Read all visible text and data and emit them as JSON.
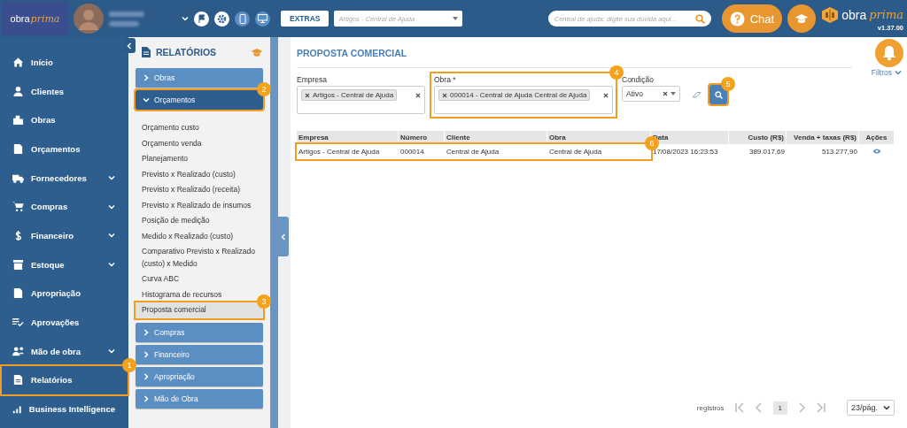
{
  "header": {
    "logo": {
      "text": "obra",
      "script": "prima"
    },
    "extras_button": "EXTRAS",
    "company_select": {
      "placeholder": "Artigos - Central de Ajuda"
    },
    "help_search": {
      "placeholder": "Central de ajuda: digite sua dúvida aqui..."
    },
    "chat_button": "Chat",
    "brand": {
      "text": "obra",
      "script": "prima",
      "version": "v1.37.00"
    }
  },
  "sidebar": {
    "items": [
      {
        "label": "Início",
        "expandable": false
      },
      {
        "label": "Clientes",
        "expandable": false
      },
      {
        "label": "Obras",
        "expandable": false
      },
      {
        "label": "Orçamentos",
        "expandable": false
      },
      {
        "label": "Fornecedores",
        "expandable": true
      },
      {
        "label": "Compras",
        "expandable": true
      },
      {
        "label": "Financeiro",
        "expandable": true
      },
      {
        "label": "Estoque",
        "expandable": true
      },
      {
        "label": "Apropriação",
        "expandable": false
      },
      {
        "label": "Aprovações",
        "expandable": false
      },
      {
        "label": "Mão de obra",
        "expandable": true
      },
      {
        "label": "Relatórios",
        "expandable": false,
        "callout": "1"
      },
      {
        "label": "Business Intelligence",
        "expandable": false
      }
    ]
  },
  "submenu": {
    "title": "RELATÓRIOS",
    "groups": [
      {
        "label": "Obras",
        "expanded": false
      },
      {
        "label": "Orçamentos",
        "expanded": true,
        "callout": "2",
        "children": [
          {
            "label": "Orçamento custo",
            "selected": false
          },
          {
            "label": "Orçamento venda",
            "selected": false
          },
          {
            "label": "Planejamento",
            "selected": false
          },
          {
            "label": "Previsto x Realizado (custo)",
            "selected": false
          },
          {
            "label": "Previsto x Realizado (receita)",
            "selected": false
          },
          {
            "label": "Previsto x Realizado de insumos",
            "selected": false
          },
          {
            "label": "Posição de medição",
            "selected": false
          },
          {
            "label": "Medido x Realizado (custo)",
            "selected": false
          },
          {
            "label": "Comparativo Previsto x Realizado (custo) x Medido",
            "selected": false
          },
          {
            "label": "Curva ABC",
            "selected": false
          },
          {
            "label": "Histograma de recursos",
            "selected": false
          },
          {
            "label": "Proposta comercial",
            "selected": true,
            "callout": "3"
          }
        ]
      },
      {
        "label": "Compras",
        "expanded": false
      },
      {
        "label": "Financeiro",
        "expanded": false
      },
      {
        "label": "Apropriação",
        "expanded": false
      },
      {
        "label": "Mão de Obra",
        "expanded": false
      }
    ]
  },
  "main": {
    "title": "PROPOSTA COMERCIAL",
    "filters_link": "Filtros",
    "filters": [
      {
        "kind": "multi",
        "label": "Empresa",
        "tags": [
          "Artigos - Central de Ajuda"
        ]
      },
      {
        "kind": "multi",
        "label": "Obra *",
        "tags": [
          "000014 - Central de Ajuda Central de Ajuda"
        ],
        "callout": "4"
      },
      {
        "kind": "select",
        "label": "Condição",
        "value": "Ativo"
      }
    ],
    "search_button": {
      "callout": "5"
    },
    "table": {
      "columns": [
        "Empresa",
        "Número",
        "Cliente",
        "Obra",
        "Data",
        "Custo (R$)",
        "Venda + taxas (R$)",
        "Ações"
      ],
      "rows": [
        {
          "cells": [
            "Artigos - Central de Ajuda",
            "000014",
            "Central de Ajuda",
            "Central de Ajuda",
            "17/08/2023 16:23:53",
            "389.017,69",
            "513.277,90"
          ],
          "callout": "6"
        }
      ]
    },
    "pagination": {
      "label": "registros",
      "page": "1",
      "per_page": "23/pág."
    }
  }
}
